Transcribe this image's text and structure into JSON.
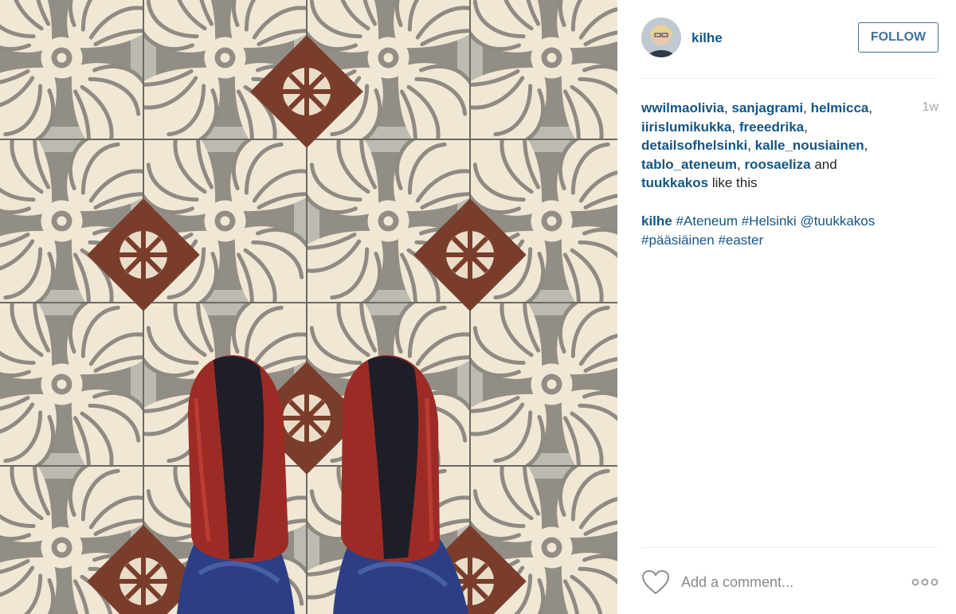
{
  "post": {
    "username": "kilhe",
    "follow_label": "FOLLOW",
    "time_ago": "1w",
    "likes": {
      "users": [
        "wwilmaolivia",
        "sanjagrami",
        "helmicca",
        "iirislumikukka",
        "freeedrika",
        "detailsofhelsinki",
        "kalle_nousiainen",
        "tablo_ateneum",
        "roosaeliza",
        "tuukkakos"
      ],
      "conjunction": "and",
      "suffix": "like this"
    },
    "caption": {
      "user": "kilhe",
      "tags": [
        "#Ateneum",
        "#Helsinki",
        "@tuukkakos",
        "#pääsiäinen",
        "#easter"
      ]
    },
    "comment_placeholder": "Add a comment..."
  },
  "icons": {
    "heart": "heart-icon",
    "more": "more-options-icon"
  },
  "colors": {
    "link": "#125688",
    "follow_border": "#3f729b",
    "muted": "#a5a7aa"
  }
}
